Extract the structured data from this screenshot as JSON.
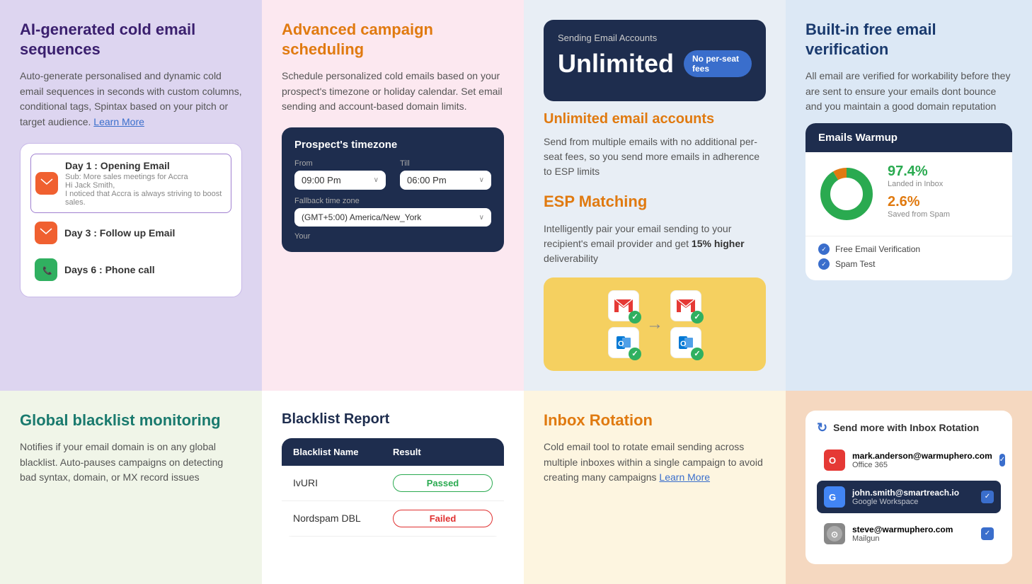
{
  "section1": {
    "title": "AI-generated cold email sequences",
    "desc": "Auto-generate personalised and dynamic cold email sequences in seconds with custom columns, conditional tags, Spintax based on your pitch or target audience.",
    "learn_more": "Learn More",
    "sequence": {
      "items": [
        {
          "id": "day1",
          "icon": "email",
          "label": "Day 1 : Opening Email",
          "sub": "Sub: More sales meetings for Accra\nHi Jack Smith,\nI noticed that Accra is always striving to boost sales.",
          "active": true
        },
        {
          "id": "day3",
          "icon": "email",
          "label": "Day 3 : Follow up Email",
          "sub": "",
          "active": false
        },
        {
          "id": "day6",
          "icon": "phone",
          "label": "Days 6 : Phone call",
          "sub": "",
          "active": false
        }
      ]
    }
  },
  "section2": {
    "title": "Advanced campaign scheduling",
    "desc": "Schedule personalized cold emails based on your prospect's timezone or holiday calendar. Set email sending and account-based domain limits.",
    "timezone_card": {
      "title": "Prospect's timezone",
      "from_label": "From",
      "from_value": "09:00 Pm",
      "till_label": "Till",
      "till_value": "06:00 Pm",
      "fallback_label": "Fallback time zone",
      "fallback_value": "(GMT+5:00) America/New_York",
      "your_label": "Your"
    }
  },
  "section3": {
    "email_accounts": {
      "header": "Sending Email Accounts",
      "unlimited_label": "Unlimited",
      "badge": "No per-seat fees",
      "title": "Unlimited email accounts",
      "desc": "Send from multiple emails with no additional per-seat fees, so you send more emails in adherence to ESP limits"
    },
    "esp_matching": {
      "title": "ESP Matching",
      "desc_prefix": "Intelligently pair your email sending to your recipient's email provider and get ",
      "highlight": "15% higher",
      "desc_suffix": " deliverability",
      "icons": [
        {
          "letter": "M",
          "color_bg": "#fff",
          "color_text": "#e53935",
          "type": "gmail"
        },
        {
          "letter": "M",
          "color_bg": "#fff",
          "color_text": "#e53935",
          "type": "gmail"
        },
        {
          "letter": "O",
          "color_bg": "#fff",
          "color_text": "#0078d4",
          "type": "outlook"
        },
        {
          "letter": "O",
          "color_bg": "#fff",
          "color_text": "#0078d4",
          "type": "outlook"
        }
      ]
    }
  },
  "section4": {
    "title": "Built-in free email verification",
    "desc": "All email are verified for workability before they are sent to ensure your emails dont bounce and you maintain a good domain reputation",
    "warmup": {
      "header": "Emails Warmup",
      "pct_inbox": "97.4%",
      "label_inbox": "Landed in Inbox",
      "pct_spam": "2.6%",
      "label_spam": "Saved from Spam",
      "checks": [
        "Free Email Verification",
        "Spam Test"
      ]
    }
  },
  "section5": {
    "title": "Global blacklist monitoring",
    "desc": "Notifies if your email domain is on any global blacklist. Auto-pauses campaigns on detecting bad syntax, domain, or MX record issues",
    "report": {
      "title": "Blacklist Report",
      "col1": "Blacklist Name",
      "col2": "Result",
      "rows": [
        {
          "name": "IvURI",
          "result": "Passed",
          "status": "passed"
        },
        {
          "name": "Nordspam DBL",
          "result": "Failed",
          "status": "failed"
        }
      ]
    }
  },
  "section6": {
    "title": "Inbox Rotation",
    "desc": "Cold email tool to rotate email sending across multiple inboxes within a single campaign to avoid creating many campaigns",
    "learn_more": "Learn More",
    "visual": {
      "title": "Send more with Inbox Rotation",
      "accounts": [
        {
          "email": "mark.anderson@warmuphero.com",
          "provider": "Office 365",
          "icon": "O",
          "icon_bg": "#e53935",
          "highlighted": false
        },
        {
          "email": "john.smith@smartreach.io",
          "provider": "Google Workspace",
          "icon": "G",
          "icon_bg": "#4285F4",
          "highlighted": true
        },
        {
          "email": "steve@warmuphero.com",
          "provider": "Mailgun",
          "icon": "M",
          "icon_bg": "#888",
          "highlighted": false
        }
      ]
    }
  },
  "icons": {
    "email": "✉",
    "phone": "📞",
    "chevron": "›",
    "check": "✓",
    "arrow": "→",
    "rotation": "↻"
  }
}
